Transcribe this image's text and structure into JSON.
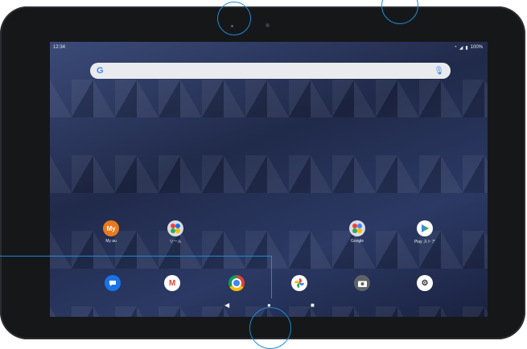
{
  "status_bar": {
    "time": "12:34",
    "battery": "100%"
  },
  "search_bar": {
    "logo": "G",
    "mic_icon": "mic-icon"
  },
  "home_apps": [
    {
      "label": "My au",
      "icon": "my-au-icon",
      "icon_text": "My",
      "color": "#e87a1e"
    },
    {
      "label": "ツール",
      "icon": "tools-folder-icon",
      "icon_text": "",
      "color": "#d9dde6"
    },
    {
      "label": "Google",
      "icon": "google-folder-icon",
      "icon_text": "",
      "color": "#d9dde6"
    },
    {
      "label": "Play ストア",
      "icon": "play-store-icon",
      "icon_text": "▶",
      "color": "#ffffff"
    }
  ],
  "dock": [
    {
      "icon": "messages-icon",
      "glyph": "●",
      "bg": "#1a73e8",
      "fg": "#ffffff"
    },
    {
      "icon": "gmail-icon",
      "glyph": "M",
      "bg": "#ffffff",
      "fg": "#ea4335"
    },
    {
      "icon": "chrome-icon",
      "glyph": "●",
      "bg": "#db4437",
      "fg": "#4285f4"
    },
    {
      "icon": "photos-icon",
      "glyph": "✦",
      "bg": "#ffffff",
      "fg": "#fbbc05"
    },
    {
      "icon": "camera-icon",
      "glyph": "◉",
      "bg": "#5f6368",
      "fg": "#ffffff"
    },
    {
      "icon": "settings-icon",
      "glyph": "⚙",
      "bg": "#ffffff",
      "fg": "#3c4043"
    }
  ],
  "nav_bar": {
    "back": "◀",
    "home": "●",
    "recents": "■"
  }
}
